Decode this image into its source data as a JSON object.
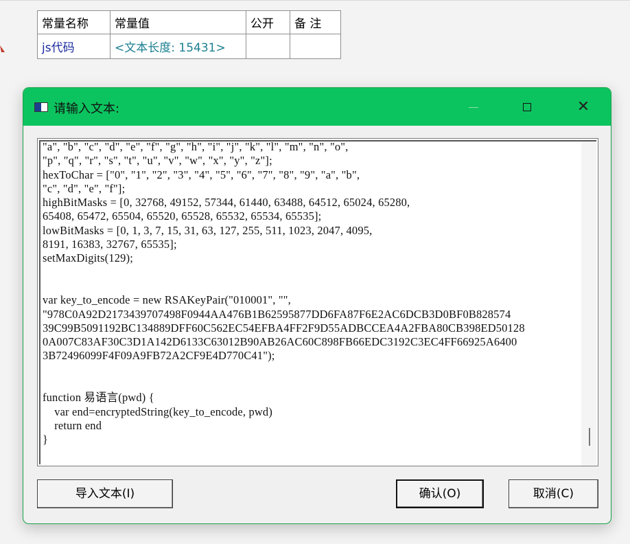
{
  "table": {
    "headers": [
      "常量名称",
      "常量值",
      "公开",
      "备 注"
    ],
    "row": {
      "name": "js代码",
      "value": "<文本长度: 15431>",
      "public": "",
      "note": ""
    }
  },
  "dialog": {
    "title": "请输入文本:",
    "content": "\"a\", \"b\", \"c\", \"d\", \"e\", \"f\", \"g\", \"h\", \"i\", \"j\", \"k\", \"l\", \"m\", \"n\", \"o\",\n\"p\", \"q\", \"r\", \"s\", \"t\", \"u\", \"v\", \"w\", \"x\", \"y\", \"z\"];\nhexToChar = [\"0\", \"1\", \"2\", \"3\", \"4\", \"5\", \"6\", \"7\", \"8\", \"9\", \"a\", \"b\",\n\"c\", \"d\", \"e\", \"f\"];\nhighBitMasks = [0, 32768, 49152, 57344, 61440, 63488, 64512, 65024, 65280,\n65408, 65472, 65504, 65520, 65528, 65532, 65534, 65535];\nlowBitMasks = [0, 1, 3, 7, 15, 31, 63, 127, 255, 511, 1023, 2047, 4095,\n8191, 16383, 32767, 65535];\nsetMaxDigits(129);\n\n\nvar key_to_encode = new RSAKeyPair(\"010001\", \"\",\n\"978C0A92D2173439707498F0944AA476B1B62595877DD6FA87F6E2AC6DCB3D0BF0B828574\n39C99B5091192BC134889DFF60C562EC54EFBA4FF2F9D55ADBCCEA4A2FBA80CB398ED50128\n0A007C83AF30C3D1A142D6133C63012B90AB26AC60C898FB66EDC3192C3EC4FF66925A6400\n3B72496099F4F09A9FB72A2CF9E4D770C41\");\n\n\nfunction 易语言(pwd) {\n    var end=encryptedString(key_to_encode, pwd)\n    return end\n}",
    "buttons": {
      "import": "导入文本(I)",
      "ok": "确认(O)",
      "cancel": "取消(C)"
    }
  }
}
